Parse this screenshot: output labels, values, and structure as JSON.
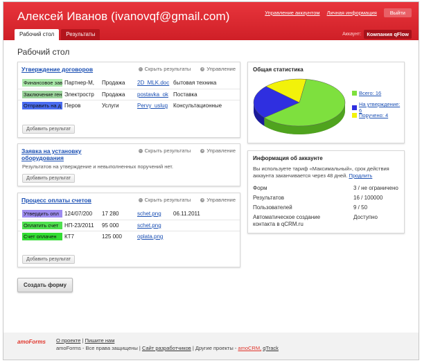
{
  "header": {
    "user": "Алексей Иванов (ivanovqf@gmail.com)",
    "links": [
      "Управление аккаунтом",
      "Личная информация"
    ],
    "logout": "Выйти",
    "tabs": [
      "Рабочий стол",
      "Результаты"
    ],
    "account_label": "Аккаунт:",
    "account_name": "Компания qFlow"
  },
  "page_title": "Рабочий стол",
  "actions": {
    "hide": "Скрыть результаты",
    "manage": "Управление",
    "add": "Добавить результат"
  },
  "forms": [
    {
      "title": "Утверждение договоров",
      "rows": [
        [
          "Финансовое зав",
          "Партнер-М,",
          "Продажа",
          "2D_MLK.doc",
          "бытовая техника"
        ],
        [
          "Заключение ген",
          "Электростр",
          "Продажа",
          "postavka_ok",
          "Поставка"
        ],
        [
          "Отправить на д",
          "Перов",
          "Услуги",
          "Pervy_uslug",
          "Консультационные"
        ]
      ],
      "status_colors": [
        "#aae8aa",
        "#9bd39b",
        "#4a6cf0"
      ]
    },
    {
      "title": "Заявка на установку оборудования",
      "note": "Результатов на утверждение и невыполненных поручений нет."
    },
    {
      "title": "Процесс оплаты счетов",
      "rows": [
        [
          "Утвердить опл",
          "124/07/200",
          "17 280",
          "schet.png",
          "06.11.2011"
        ],
        [
          "Оплатить счет",
          "НП-23/2011",
          "95 000",
          "schet.png",
          ""
        ],
        [
          "Счет оплачен",
          "КТ7",
          "125 000",
          "oplata.png",
          ""
        ]
      ],
      "status_colors": [
        "#9d8cf0",
        "#4fe04f",
        "#33dd33"
      ]
    }
  ],
  "create_form": "Создать форму",
  "stats": {
    "title": "Общая статистика",
    "legend": [
      {
        "label": "Всего: 16",
        "color": "#7ee03e"
      },
      {
        "label": "На утверждение: 6",
        "color": "#2f2fe0"
      },
      {
        "label": "Поручено: 4",
        "color": "#f2f20a"
      }
    ]
  },
  "chart_data": {
    "type": "pie",
    "categories": [
      "Всего: 16",
      "На утверждение: 6",
      "Поручено: 4"
    ],
    "values": [
      16,
      6,
      4
    ],
    "title": "Общая статистика"
  },
  "account_info": {
    "title": "Информация об аккаунте",
    "line1": "Вы используете тариф «Максимальный», срок действия",
    "line2": "аккаунта заканчивается через 48 дней.",
    "renew": "Продлить",
    "rows": [
      {
        "k": "Форм",
        "v": "3 / не ограничено"
      },
      {
        "k": "Результатов",
        "v": "16 / 100000"
      },
      {
        "k": "Пользователей",
        "v": "9 / 50"
      },
      {
        "k": "Автоматическое создание контакта в qCRM.ru",
        "v": "Доступно"
      }
    ]
  },
  "footer": {
    "logo": "amoForms",
    "about": "О проекте",
    "write": "Пишите нам",
    "copyright": "amoForms - Все права защищены",
    "dev": "Сайт разработчиков",
    "other": "Другие проекты -",
    "amocrm": "amoCRM,",
    "qtrack": "qTrack"
  }
}
